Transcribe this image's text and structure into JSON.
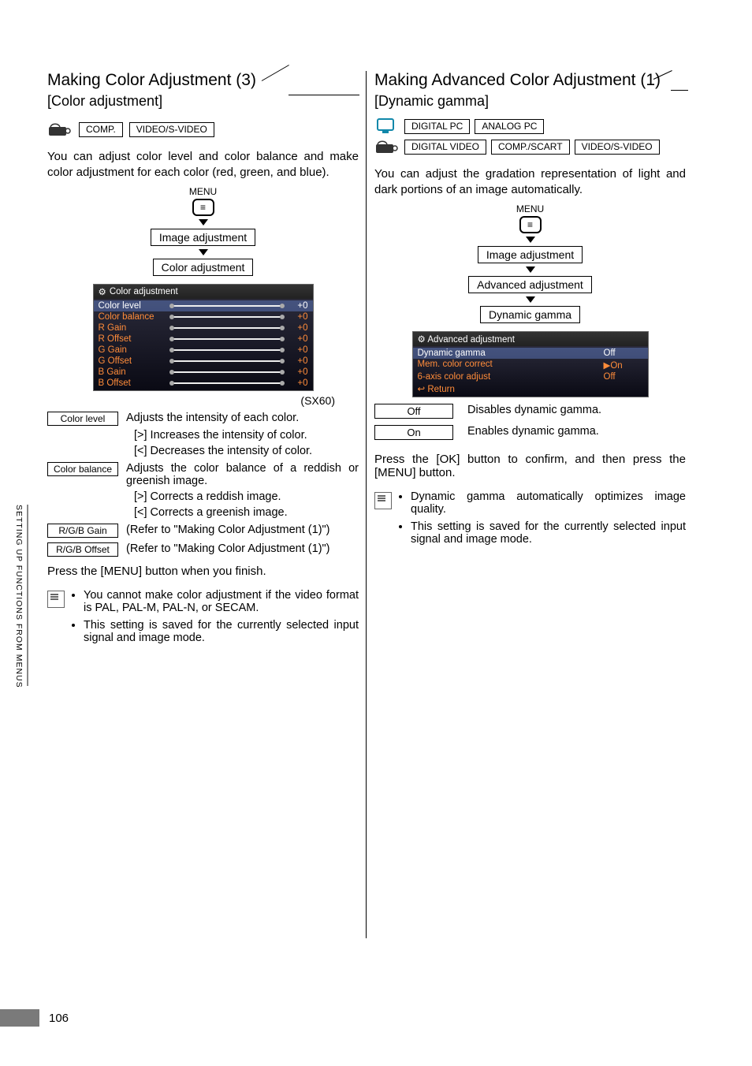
{
  "sideText": "SETTING UP FUNCTIONS FROM MENUS",
  "pageNumber": "106",
  "left": {
    "title": "Making Color Adjustment (3)",
    "subtitle": "[Color adjustment]",
    "badges": {
      "row1": [
        "COMP.",
        "VIDEO/S-VIDEO"
      ]
    },
    "intro": "You can adjust color level and color balance and make color adjustment for each color (red, green, and blue).",
    "menuLabel": "MENU",
    "flow": [
      "Image adjustment",
      "Color adjustment"
    ],
    "osdTitle": "Color adjustment",
    "osdRows": [
      {
        "label": "Color level",
        "value": "+0"
      },
      {
        "label": "Color balance",
        "value": "+0"
      },
      {
        "label": "R Gain",
        "value": "+0"
      },
      {
        "label": "R Offset",
        "value": "+0"
      },
      {
        "label": "G Gain",
        "value": "+0"
      },
      {
        "label": "G Offset",
        "value": "+0"
      },
      {
        "label": "B Gain",
        "value": "+0"
      },
      {
        "label": "B Offset",
        "value": "+0"
      }
    ],
    "sx60": "(SX60)",
    "defs": {
      "colorLevel": {
        "key": "Color level",
        "val": "Adjusts the intensity of each color."
      },
      "colorLevelInc": "[>] Increases the intensity of color.",
      "colorLevelDec": "[<] Decreases the intensity of color.",
      "colorBalance": {
        "key": "Color balance",
        "val": "Adjusts the color balance of a reddish or greenish image."
      },
      "colorBalanceR": "[>] Corrects a reddish image.",
      "colorBalanceG": "[<] Corrects a greenish image.",
      "rgbGain": {
        "key": "R/G/B Gain",
        "val": "(Refer to \"Making Color Adjustment (1)\")"
      },
      "rgbOffset": {
        "key": "R/G/B Offset",
        "val": "(Refer to \"Making Color Adjustment (1)\")"
      }
    },
    "pressLine": "Press the [MENU] button when you finish.",
    "notes": [
      "You cannot make color adjustment if the video format is PAL, PAL-M, PAL-N, or SECAM.",
      "This setting is saved for the currently selected input signal and image mode."
    ]
  },
  "right": {
    "title": "Making Advanced Color Adjustment (1)",
    "subtitle": "[Dynamic gamma]",
    "badges": {
      "row1": [
        "DIGITAL PC",
        "ANALOG PC"
      ],
      "row2": [
        "DIGITAL VIDEO",
        "COMP./SCART",
        "VIDEO/S-VIDEO"
      ]
    },
    "intro": "You can adjust the gradation representation of light and dark portions of an image automatically.",
    "menuLabel": "MENU",
    "flow": [
      "Image adjustment",
      "Advanced adjustment",
      "Dynamic gamma"
    ],
    "osdTitle": "Advanced adjustment",
    "osdRows": [
      {
        "label": "Dynamic gamma",
        "value": "Off"
      },
      {
        "label": "Mem. color correct",
        "value": "▶On"
      },
      {
        "label": "6-axis color adjust",
        "value": "Off"
      },
      {
        "label": "Return",
        "value": ""
      }
    ],
    "options": {
      "off": {
        "key": "Off",
        "val": "Disables dynamic gamma."
      },
      "on": {
        "key": "On",
        "val": "Enables dynamic gamma."
      }
    },
    "pressLine": "Press the [OK] button to confirm, and then press the [MENU] button.",
    "notes": [
      "Dynamic gamma automatically optimizes image quality.",
      "This setting is saved for the currently selected input signal and image mode."
    ]
  }
}
